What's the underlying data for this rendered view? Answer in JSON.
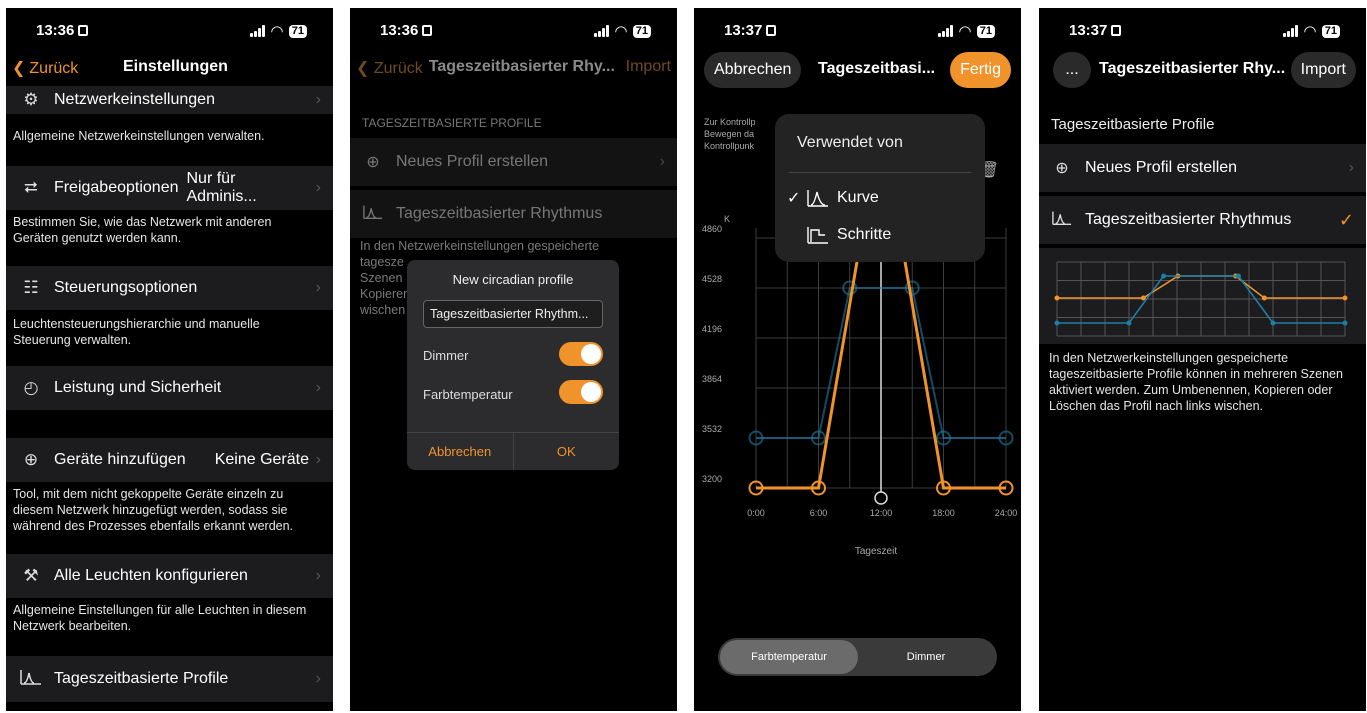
{
  "status": {
    "p1_time": "13:36",
    "p2_time": "13:36",
    "p3_time": "13:37",
    "p4_time": "13:37",
    "battery": "71"
  },
  "screen1": {
    "back": "Zurück",
    "title": "Einstellungen",
    "items": [
      {
        "label": "Netzwerkeinstellungen",
        "value": "",
        "icon": "network-gear-icon",
        "desc": "Allgemeine Netzwerkeinstellungen verwalten."
      },
      {
        "label": "Freigabeoptionen",
        "value": "Nur für Adminis...",
        "icon": "share-icon",
        "desc": "Bestimmen Sie, wie das Netzwerk mit anderen Geräten genutzt werden kann."
      },
      {
        "label": "Steuerungsoptionen",
        "value": "",
        "icon": "hierarchy-icon",
        "desc": "Leuchtensteuerungshierarchie und manuelle Steuerung verwalten."
      },
      {
        "label": "Leistung und Sicherheit",
        "value": "",
        "icon": "gauge-icon",
        "desc": ""
      },
      {
        "label": "Geräte hinzufügen",
        "value": "Keine Geräte",
        "icon": "plus-circle-icon",
        "desc": "Tool, mit dem nicht gekoppelte Geräte einzeln zu diesem Netzwerk hinzugefügt werden, sodass sie während des Prozesses ebenfalls erkannt werden."
      },
      {
        "label": "Alle Leuchten konfigurieren",
        "value": "",
        "icon": "tools-icon",
        "desc": "Allgemeine Einstellungen für alle Leuchten in diesem Netzwerk bearbeiten."
      },
      {
        "label": "Tageszeitbasierte Profile",
        "value": "",
        "icon": "curve-icon",
        "desc": ""
      }
    ]
  },
  "screen2": {
    "back": "Zurück",
    "title": "Tageszeitbasierter Rhy...",
    "import": "Import",
    "section": "TAGESZEITBASIERTE PROFILE",
    "new_profile": "Neues Profil erstellen",
    "profile": "Tageszeitbasierter Rhythmus",
    "desc_lines": [
      "In den Netzwerkeinstellungen gespeicherte",
      "tagesze",
      "Szenen",
      "Kopieren",
      "wischen"
    ],
    "dialog": {
      "title": "New circadian profile",
      "input_value": "Tageszeitbasierter Rhythm...",
      "dimmer": "Dimmer",
      "color_temp": "Farbtemperatur",
      "cancel": "Abbrechen",
      "ok": "OK"
    }
  },
  "screen3": {
    "cancel": "Abbrechen",
    "title": "Tageszeitbasi...",
    "done": "Fertig",
    "hint_lines": [
      "Zur Kontrollp",
      "Bewegen da",
      "Kontrollpunk"
    ],
    "popup": {
      "title": "Verwendet von",
      "option1": "Kurve",
      "option2": "Schritte",
      "selected": "Kurve"
    },
    "segment_on": "Farbtemperatur",
    "segment_off": "Dimmer",
    "colors": {
      "orange": "#f0932b",
      "blue": "#1b7fa8"
    }
  },
  "chart_data": {
    "type": "line",
    "xlabel": "Tageszeit",
    "ylabel": "K",
    "xticks": [
      "0:00",
      "6:00",
      "12:00",
      "18:00",
      "24:00"
    ],
    "yticks": [
      "3200",
      "3532",
      "3864",
      "4196",
      "4528",
      "4860"
    ],
    "ylim": [
      3200,
      4860
    ],
    "x": [
      0,
      1,
      2,
      3,
      4
    ],
    "series": [
      {
        "name": "",
        "values": [
          3200,
          3200,
          4860,
          4860,
          3200,
          3200
        ],
        "x": [
          0,
          0.25,
          0.42,
          0.58,
          0.75,
          1
        ]
      },
      {
        "name": "",
        "values": [
          3532,
          3532,
          4528,
          4528,
          3532,
          3532
        ],
        "x": [
          0,
          0.25,
          0.375,
          0.625,
          0.75,
          1
        ]
      }
    ],
    "grid": true
  },
  "screen4": {
    "more": "...",
    "title": "Tageszeitbasierter Rhy...",
    "import": "Import",
    "section": "Tageszeitbasierte Profile",
    "new_profile": "Neues Profil erstellen",
    "profile": "Tageszeitbasierter Rhythmus",
    "desc": "In den Netzwerkeinstellungen gespeicherte tageszeitbasierte Profile können in mehreren Szenen aktiviert werden. Zum Umbenennen, Kopieren oder Löschen  das Profil nach links wischen."
  }
}
